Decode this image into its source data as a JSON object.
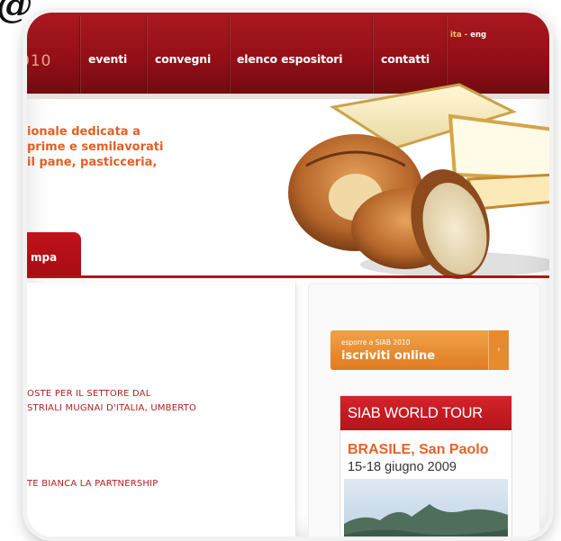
{
  "corner_logo": "@",
  "header": {
    "year": "010",
    "nav": [
      "eventi",
      "convegni",
      "elenco espositori",
      "contatti"
    ],
    "lang": {
      "ita": "ita",
      "sep": "-",
      "eng": "eng"
    }
  },
  "intro": {
    "lines": [
      "ionale dedicata a",
      "prime e semilavorati",
      "il pane, pasticceria,"
    ]
  },
  "tabs": {
    "active": "mpa"
  },
  "news": [
    "OSTE PER IL SETTORE DAL",
    "STRIALI MUGNAI D'ITALIA, UMBERTO",
    "TE BIANCA LA PARTNERSHIP"
  ],
  "sidebar": {
    "signup": {
      "small": "esporre a SIAB 2010",
      "big": "iscriviti online",
      "arrow": "›"
    },
    "tour": {
      "title": "SIAB WORLD TOUR",
      "city": "BRASILE, San Paolo",
      "dates": "15-18 giugno 2009"
    }
  },
  "colors": {
    "header": "#9a1118",
    "accent": "#e06025",
    "orange": "#e98a2c",
    "red": "#c8171f"
  }
}
